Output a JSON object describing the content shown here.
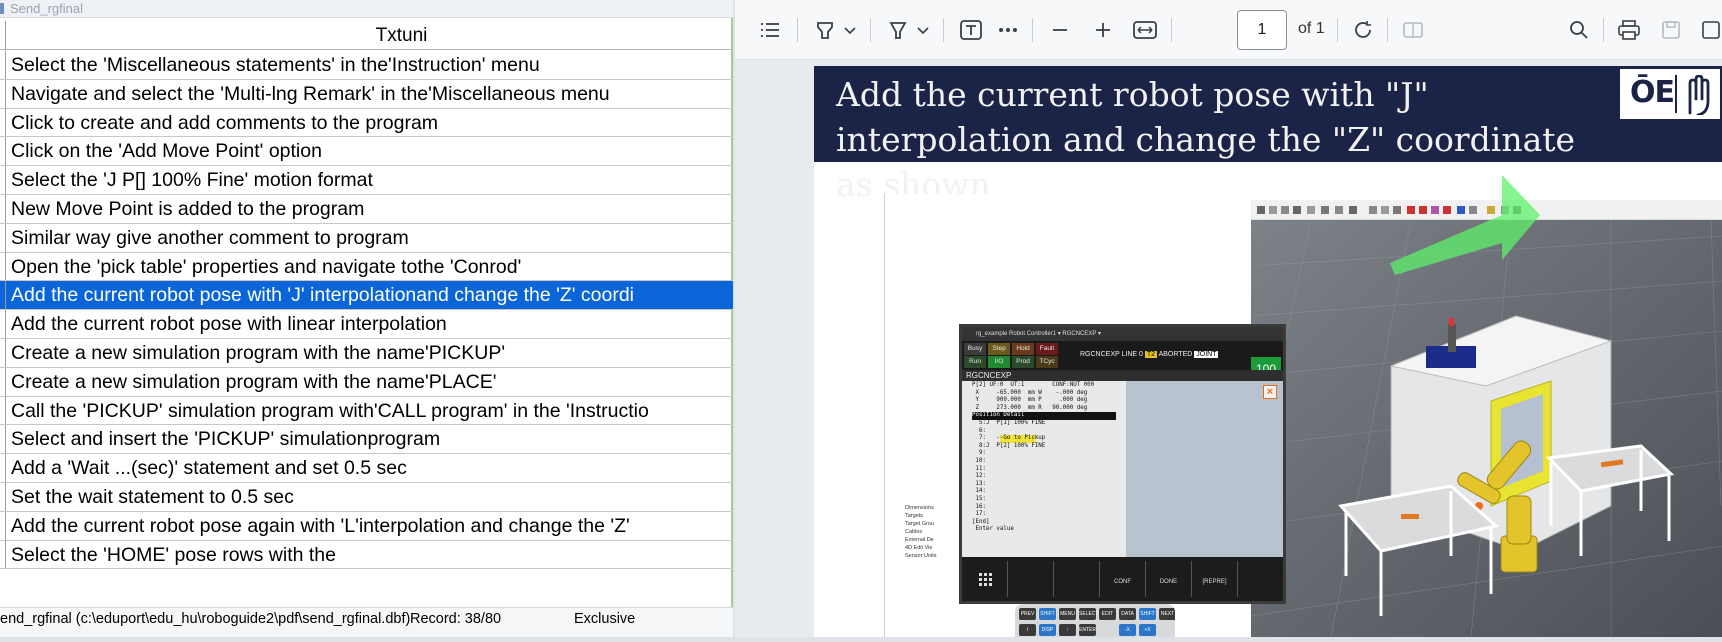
{
  "left_window": {
    "title": "Send_rgfinal",
    "column_header": "Txtuni",
    "rows": [
      "Select the 'Miscellaneous statements' in the'Instruction' menu",
      "Navigate and select the 'Multi-lng Remark' in the'Miscellaneous menu",
      "Click to create and add comments to the program",
      "Click on the 'Add Move Point' option",
      "Select the 'J P[] 100% Fine' motion format",
      "New Move Point is added to the program",
      "Similar way give another comment to program",
      "Open the 'pick table' properties and navigate tothe 'Conrod'",
      "Add the current robot pose with 'J' interpolationand change the 'Z' coordi",
      "Add the current robot pose with linear interpolation",
      "Create a new simulation program with the name'PICKUP'",
      "Create a new simulation program with the name'PLACE'",
      "Call the 'PICKUP' simulation program with'CALL program' in the 'Instructio",
      "Select and insert the 'PICKUP' simulationprogram",
      "Add a 'Wait ...(sec)' statement and set 0.5 sec",
      "Set the wait statement to 0.5 sec",
      "Add the current robot pose again with 'L'interpolation and change the 'Z'",
      "Select the 'HOME' pose rows with the"
    ],
    "selected_index": 8,
    "status": {
      "path": "end_rgfinal (c:\\eduport\\edu_hu\\roboguide2\\pdf\\send_rgfinal.dbf)",
      "record": "Record: 38/80",
      "mode": "Exclusive"
    },
    "colors": {
      "selection": "#0a66d8"
    }
  },
  "viewer": {
    "page_number": "1",
    "page_total": "of 1",
    "banner_text": "Add the current robot pose with \"J\" interpolation and change the \"Z\" coordinate as shown",
    "logo_text": "ŌE",
    "colors": {
      "banner": "#1b2447",
      "arrow": "#5ef06a"
    }
  },
  "pendant": {
    "header": "rg_example   Robot Controller1 ▾   RGCNCEXP ▾",
    "status_buttons": [
      "Busy",
      "Step",
      "Hold",
      "Fault",
      "Run",
      "I/O",
      "Prod",
      "TCyc"
    ],
    "status_line": "RGCNCEXP LINE 0",
    "t2": "T2",
    "aborted": "ABORTED",
    "joint": "JOINT",
    "override": "100",
    "title": "RGCNCEXP",
    "screen_lines": [
      "P[2] UF:0  UT:1        CONF:NUT 000",
      " X     -65.000  mm W    -.000 deg",
      " Y     900.000  mm P     .000 deg",
      " Z     273.000  mm R   90.000 deg",
      "Position Detail",
      "  5:J  P[1] 100% FINE",
      "  6:",
      "  7:   --Go to Pickup",
      "  8:J  P[2] 100% FINE",
      "  9:",
      " 10:",
      " 11:",
      " 12:",
      " 13:",
      " 14:",
      " 15:",
      " 16:",
      " 17:",
      "[End]",
      "",
      "",
      " Enter value"
    ],
    "fkeys": [
      "CONF",
      "DONE",
      "[REPRE]"
    ],
    "tree_items": [
      "Dimensions",
      "Targets",
      "Target Grou",
      "Cables",
      "External De",
      "4D Edit Vie",
      "Sensor Units"
    ]
  }
}
